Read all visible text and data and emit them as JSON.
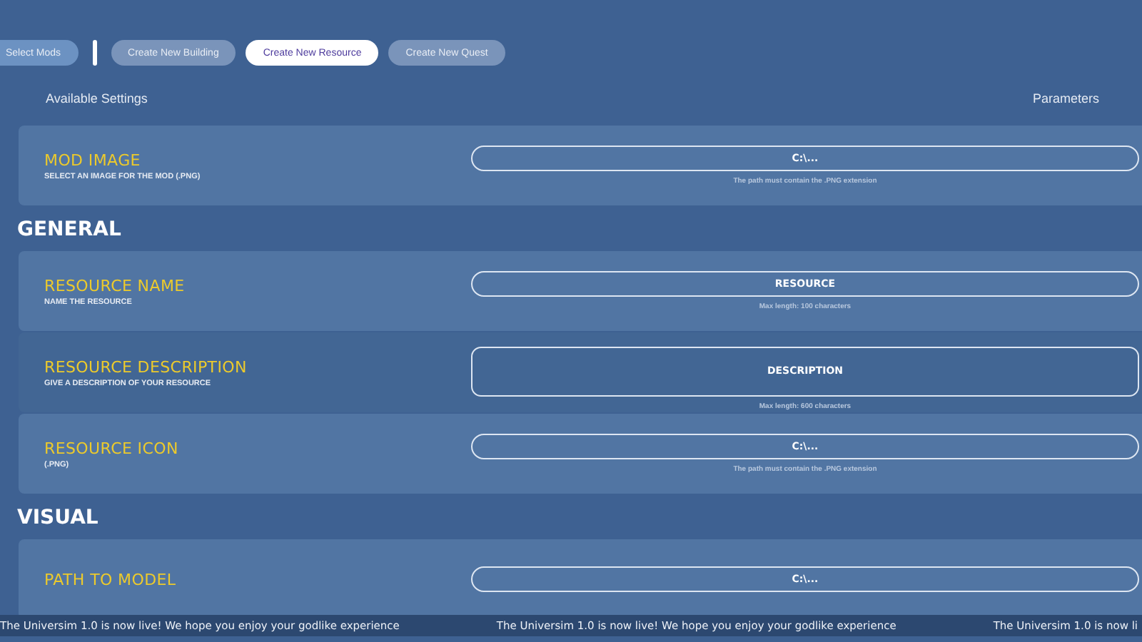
{
  "tabs": [
    {
      "label": "Select Mods",
      "kind": "nav",
      "selected": false
    },
    {
      "label": "Create New Building",
      "kind": "create",
      "selected": false
    },
    {
      "label": "Create New Resource",
      "kind": "create",
      "selected": true
    },
    {
      "label": "Create New Quest",
      "kind": "create",
      "selected": false
    }
  ],
  "columns": {
    "settings": "Available Settings",
    "parameters": "Parameters"
  },
  "groups": [
    {
      "settings": [
        {
          "title": "MOD IMAGE",
          "description": "SELECT AN IMAGE FOR THE MOD (.PNG)",
          "field": {
            "kind": "line",
            "value": "C:\\...",
            "hint": "The path must contain the .PNG extension"
          }
        }
      ]
    },
    {
      "heading": "GENERAL",
      "settings": [
        {
          "title": "RESOURCE NAME",
          "description": "NAME THE RESOURCE",
          "field": {
            "kind": "line",
            "value": "RESOURCE",
            "hint": "Max length: 100 characters"
          }
        },
        {
          "title": "RESOURCE DESCRIPTION",
          "description": "GIVE A DESCRIPTION OF YOUR RESOURCE",
          "field": {
            "kind": "area",
            "value": "DESCRIPTION",
            "hint": "Max length: 600 characters"
          }
        },
        {
          "title": "RESOURCE ICON",
          "description": "(.PNG)",
          "field": {
            "kind": "line",
            "value": "C:\\...",
            "hint": "The path must contain the .PNG extension"
          }
        }
      ]
    },
    {
      "heading": "VISUAL",
      "settings": [
        {
          "title": "PATH TO MODEL",
          "field": {
            "kind": "line",
            "value": "C:\\..."
          }
        }
      ]
    }
  ],
  "ticker": [
    "The Universim 1.0 is now live! We hope you enjoy your godlike experience",
    "The Universim 1.0 is now live! We hope you enjoy your godlike experience",
    "The Universim 1.0 is now li"
  ]
}
